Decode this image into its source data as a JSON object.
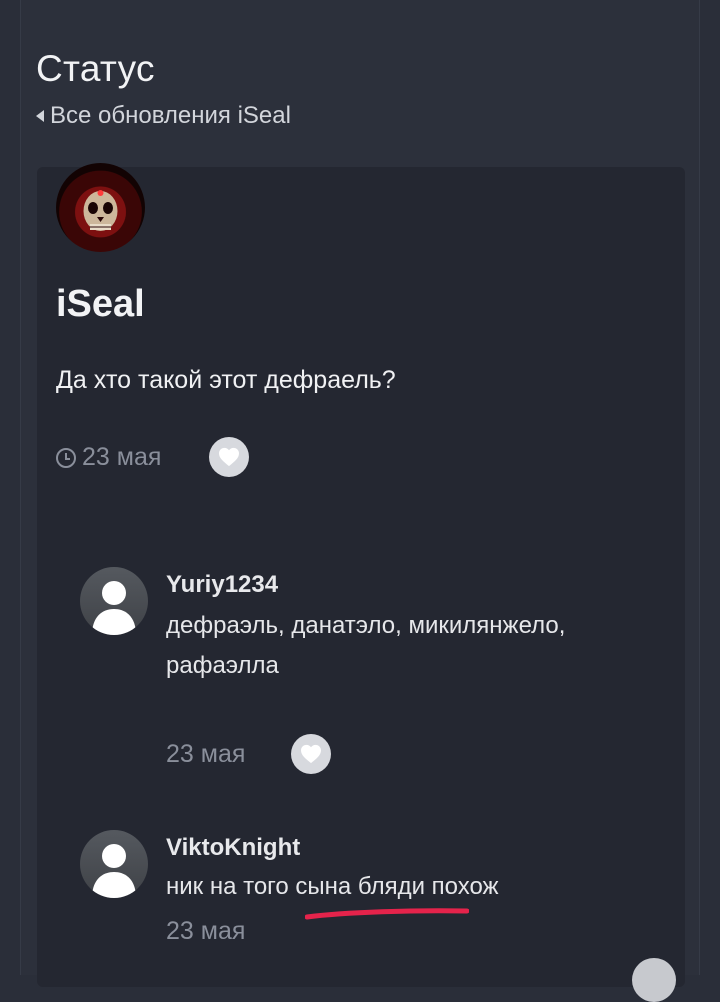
{
  "header": {
    "title": "Статус",
    "breadcrumb": "Все обновления iSeal"
  },
  "status": {
    "author": "iSeal",
    "text": "Да хто такой этот дефраель?",
    "date": "23 мая"
  },
  "replies": [
    {
      "author": "Yuriy1234",
      "text": "дефраэль, данатэло, микилянжело, рафаэлла",
      "date": "23 мая"
    },
    {
      "author": "ViktoKnight",
      "text": "ник на того сына бляди похож",
      "date": "23 мая"
    }
  ],
  "colors": {
    "page_bg": "#2a2e39",
    "card_bg": "#242731",
    "text": "#f0f1f3",
    "muted": "#8a8f9b",
    "like_button": "#d7d9de",
    "annotation_underline": "#e5234b"
  },
  "icons": {
    "breadcrumb": "caret-left-icon",
    "date": "clock-icon",
    "like": "heart-icon",
    "avatar": "default-user-icon"
  }
}
